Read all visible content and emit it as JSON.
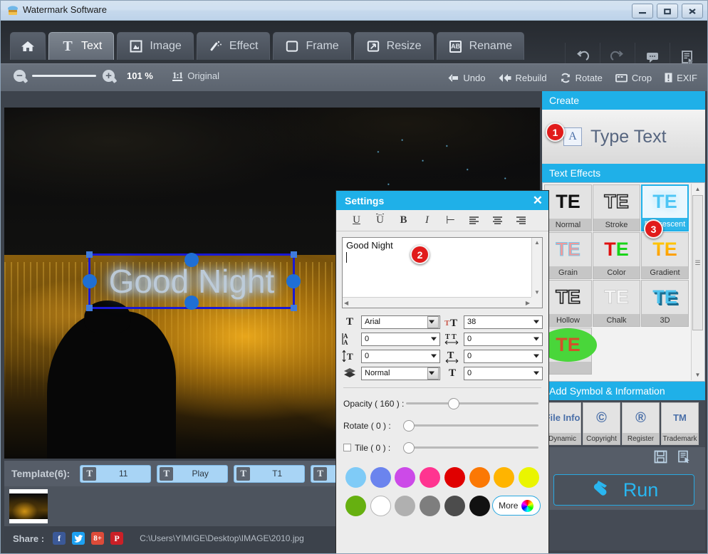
{
  "window": {
    "title": "Watermark Software",
    "icon": "app-icon",
    "controls": [
      {
        "name": "minimize-button",
        "glyph": "minimize-icon"
      },
      {
        "name": "maximize-button",
        "glyph": "maximize-icon"
      },
      {
        "name": "close-button",
        "glyph": "close-icon"
      }
    ]
  },
  "tabs": [
    {
      "label": "",
      "icon": "home-icon",
      "active": false
    },
    {
      "label": "Text",
      "icon": "text-T-icon",
      "active": true
    },
    {
      "label": "Image",
      "icon": "image-icon",
      "active": false
    },
    {
      "label": "Effect",
      "icon": "magic-wand-icon",
      "active": false
    },
    {
      "label": "Frame",
      "icon": "frame-icon",
      "active": false
    },
    {
      "label": "Resize",
      "icon": "resize-arrow-icon",
      "active": false
    },
    {
      "label": "Rename",
      "icon": "ab-rename-icon",
      "active": false
    }
  ],
  "top_right_buttons": [
    {
      "name": "undo-history-button",
      "icon": "undo-arrow-icon"
    },
    {
      "name": "redo-button",
      "icon": "redo-arrow-icon"
    },
    {
      "name": "feedback-button",
      "icon": "speech-bubble-icon"
    },
    {
      "name": "register-button",
      "icon": "document-cursor-icon"
    }
  ],
  "actionbar": {
    "zoom_out": "zoom-out-icon",
    "zoom_in": "zoom-in-icon",
    "zoom_value": "101 %",
    "one_to_one_icon": "1:1",
    "one_to_one_label": "Original",
    "actions": [
      {
        "label": "Undo",
        "icon": "undo-triangle-icon"
      },
      {
        "label": "Rebuild",
        "icon": "rebuild-double-triangle-icon"
      },
      {
        "label": "Rotate",
        "icon": "rotate-circular-icon"
      },
      {
        "label": "Crop",
        "icon": "crop-icon"
      },
      {
        "label": "EXIF",
        "icon": "exif-info-icon"
      }
    ]
  },
  "canvas": {
    "watermark_text": "Good Night"
  },
  "templates": {
    "label": "Template(6):",
    "items": [
      {
        "icon": "T",
        "name": "11"
      },
      {
        "icon": "T",
        "name": "Play"
      },
      {
        "icon": "T",
        "name": "T1"
      },
      {
        "icon": "T",
        "name": ""
      }
    ]
  },
  "share": {
    "label": "Share :",
    "networks": [
      {
        "name": "facebook-icon",
        "glyph": "f"
      },
      {
        "name": "twitter-icon",
        "glyph": "t"
      },
      {
        "name": "google-plus-icon",
        "glyph": "8+"
      },
      {
        "name": "pinterest-icon",
        "glyph": "P"
      }
    ],
    "file_path": "C:\\Users\\YIMIGE\\Desktop\\IMAGE\\2010.jpg"
  },
  "sidebar": {
    "create": {
      "header": "Create",
      "button_label": "Type Text",
      "button_icon": "A"
    },
    "text_effects": {
      "header": "Text Effects",
      "items": [
        {
          "label": "Normal",
          "art": "TE",
          "selected": false
        },
        {
          "label": "Stroke",
          "art": "TE",
          "selected": false
        },
        {
          "label": "Fluorescent",
          "art": "TE",
          "selected": true
        },
        {
          "label": "Grain",
          "art": "TE",
          "selected": false
        },
        {
          "label": "Color",
          "art": "TE",
          "selected": false
        },
        {
          "label": "Gradient",
          "art": "TE",
          "selected": false
        },
        {
          "label": "Hollow",
          "art": "TE",
          "selected": false
        },
        {
          "label": "Chalk",
          "art": "TE",
          "selected": false
        },
        {
          "label": "3D",
          "art": "TE",
          "selected": false
        },
        {
          "label": "",
          "art": "TE",
          "selected": false
        }
      ]
    },
    "symbols": {
      "header": "Add Symbol & Information",
      "items": [
        {
          "label": "Dynamic",
          "art": "File Info",
          "icon": "file-info-icon"
        },
        {
          "label": "Copyright",
          "art": "©",
          "icon": "copyright-icon"
        },
        {
          "label": "Register",
          "art": "®",
          "icon": "registered-icon"
        },
        {
          "label": "Trademark",
          "art": "TM",
          "icon": "trademark-icon"
        }
      ]
    },
    "save_buttons": [
      {
        "name": "save-template-button",
        "icon": "floppy-save-icon"
      },
      {
        "name": "save-as-button",
        "icon": "save-as-icon"
      }
    ],
    "run": {
      "label": "Run",
      "icon": "stamp-icon"
    }
  },
  "dialog": {
    "title": "Settings",
    "close": "✕",
    "toolbar": [
      {
        "name": "underline-button",
        "glyph": "U"
      },
      {
        "name": "overline-button",
        "glyph": "Ü"
      },
      {
        "name": "bold-button",
        "glyph": "B"
      },
      {
        "name": "italic-button",
        "glyph": "I"
      },
      {
        "name": "align-left-edge-button",
        "glyph": "⊢"
      },
      {
        "name": "align-left-button",
        "glyph": "≡"
      },
      {
        "name": "align-center-button",
        "glyph": "≡"
      },
      {
        "name": "align-right-button",
        "glyph": "≡"
      }
    ],
    "textarea": {
      "value": "Good Night"
    },
    "fields": [
      {
        "name": "font-family-select",
        "icon": "font-T-icon",
        "value": "Arial",
        "style": "button"
      },
      {
        "name": "font-size-select",
        "icon": "font-size-icon",
        "value": "38",
        "style": "flat"
      },
      {
        "name": "letter-case-select",
        "icon": "letter-case-icon",
        "value": "0",
        "style": "flat"
      },
      {
        "name": "letter-spacing-select",
        "icon": "letter-spacing-icon",
        "value": "0",
        "style": "flat"
      },
      {
        "name": "line-height-select",
        "icon": "line-height-icon",
        "value": "0",
        "style": "flat"
      },
      {
        "name": "text-width-select",
        "icon": "text-width-icon",
        "value": "0",
        "style": "flat"
      },
      {
        "name": "blend-mode-select",
        "icon": "layers-icon",
        "value": "Normal",
        "style": "button"
      },
      {
        "name": "text-shadow-select",
        "icon": "font-outline-icon",
        "value": "0",
        "style": "flat"
      }
    ],
    "sliders": [
      {
        "name": "opacity-slider",
        "label": "Opacity ( 160 ) :",
        "value": 160,
        "pos_pct": 36,
        "checkbox": false
      },
      {
        "name": "rotate-slider",
        "label": "Rotate ( 0 ) :",
        "value": 0,
        "pos_pct": 0,
        "checkbox": false
      },
      {
        "name": "tile-slider",
        "label": "Tile ( 0 ) :",
        "value": 0,
        "pos_pct": 0,
        "checkbox": true
      }
    ],
    "colors_row1": [
      "#7fcbf7",
      "#6b84ee",
      "#cc4ae8",
      "#ff3490",
      "#e00000",
      "#fb7804",
      "#ffb400",
      "#eaf500"
    ],
    "colors_row2": [
      "#66b010",
      "#ffffff",
      "#b0b0b0",
      "#7e7e7e",
      "#4c4c4c",
      "#111111"
    ],
    "more_label": "More"
  },
  "callouts": [
    {
      "number": "1",
      "target": "type-text-button"
    },
    {
      "number": "2",
      "target": "settings-textarea"
    },
    {
      "number": "3",
      "target": "fluorescent-effect"
    }
  ]
}
